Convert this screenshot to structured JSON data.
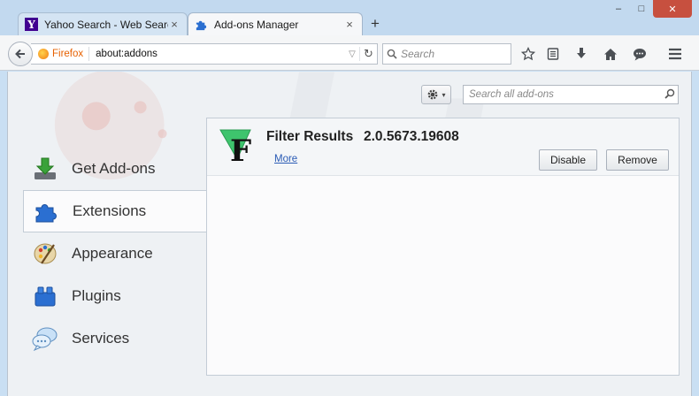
{
  "tabs": [
    {
      "label": "Yahoo Search - Web Search",
      "icon": "yahoo-favicon",
      "active": false
    },
    {
      "label": "Add-ons Manager",
      "icon": "puzzle-favicon",
      "active": true
    }
  ],
  "tab_close_glyph": "×",
  "new_tab_glyph": "+",
  "window": {
    "minimize": "–",
    "restore": "□",
    "close": "✕"
  },
  "urlbar": {
    "identity_label": "Firefox",
    "url": "about:addons"
  },
  "searchbar": {
    "placeholder": "Search"
  },
  "addons_search": {
    "placeholder": "Search all add-ons"
  },
  "categories": [
    {
      "label": "Get Add-ons",
      "icon": "download-icon",
      "selected": false
    },
    {
      "label": "Extensions",
      "icon": "puzzle-icon",
      "selected": true
    },
    {
      "label": "Appearance",
      "icon": "palette-icon",
      "selected": false
    },
    {
      "label": "Plugins",
      "icon": "plugin-blocks-icon",
      "selected": false
    },
    {
      "label": "Services",
      "icon": "chat-bubbles-icon",
      "selected": false
    }
  ],
  "addon": {
    "name": "Filter Results",
    "version": "2.0.5673.19608",
    "more_link": "More",
    "disable_label": "Disable",
    "remove_label": "Remove"
  },
  "colors": {
    "accent_link": "#2a5bb5",
    "close_button": "#c7503f",
    "tab_strip": "#c2d9ef"
  }
}
